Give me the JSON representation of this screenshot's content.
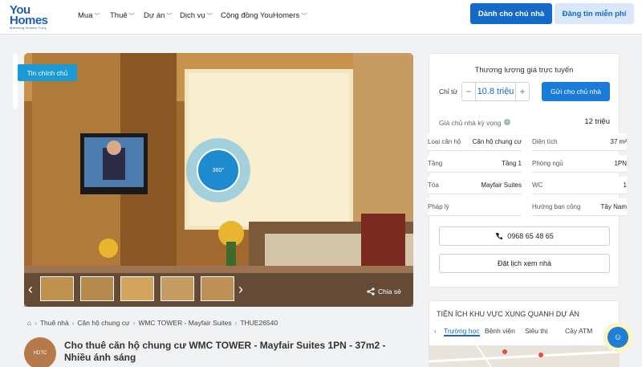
{
  "header": {
    "logo_line1": "You",
    "logo_line2": "Homes",
    "logo_tagline": "Matching Homes Truly",
    "nav": [
      "Mua",
      "Thuê",
      "Dự án",
      "Dịch vụ",
      "Cộng đồng YouHomers"
    ],
    "btn_owner": "Dành cho chủ nhà",
    "btn_post": "Đăng tin miễn phí"
  },
  "gallery": {
    "badge": "Tin chính chủ",
    "pano_label": "360°",
    "share": "Chia sẻ"
  },
  "breadcrumb": [
    "Thuê nhà",
    "Căn hộ chung cư",
    "WMC TOWER - Mayfair Suites",
    "THUE26540"
  ],
  "listing": {
    "owner_badge": "HDTC",
    "title": "Cho thuê căn hộ chung cư WMC TOWER - Mayfair Suites 1PN - 37m2 - Nhiều ánh sáng"
  },
  "offer": {
    "heading": "Thương lượng giá trực tuyến",
    "from_label": "Chỉ từ",
    "value": "10.8 triệu",
    "minus": "−",
    "plus": "+",
    "send": "Gửi cho chủ nhà",
    "expected_label": "Giá chủ nhà kỳ vọng",
    "expected_value": "12 triệu"
  },
  "specs": [
    {
      "k": "Loại căn hộ",
      "v": "Căn hộ chung cư",
      "k2": "Diện tích",
      "v2": "37 m²"
    },
    {
      "k": "Tầng",
      "v": "Tầng 1",
      "k2": "Phòng ngủ",
      "v2": "1PN"
    },
    {
      "k": "Tòa",
      "v": "Mayfair Suites",
      "k2": "WC",
      "v2": "1"
    },
    {
      "k": "Pháp lý",
      "v": "",
      "k2": "Hướng ban công",
      "v2": "Tây Nam"
    }
  ],
  "contact": {
    "phone": "0968 65 48 65",
    "schedule": "Đặt lịch xem nhà"
  },
  "amenities": {
    "title": "TIỆN ÍCH KHU VỰC XUNG QUANH DỰ ÁN",
    "tabs": [
      "Trường học",
      "Bệnh viện",
      "Siêu thị",
      "Cây ATM"
    ]
  },
  "colors": {
    "primary": "#1569c7",
    "accent": "#1b9ad6"
  }
}
